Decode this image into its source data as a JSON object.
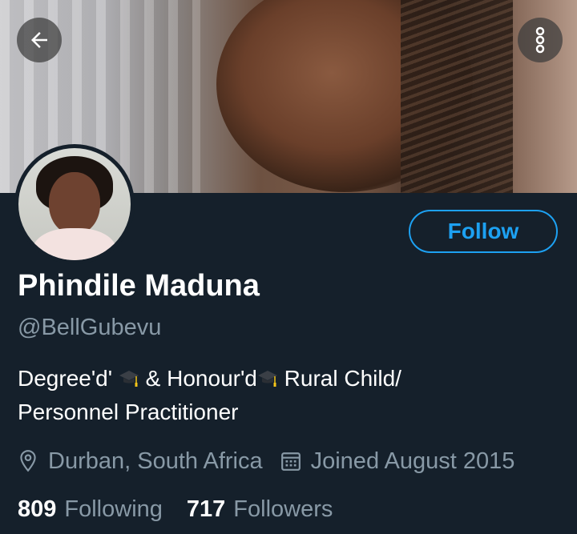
{
  "profile": {
    "name": "Phindile Maduna",
    "handle": "@BellGubevu",
    "bio": {
      "part1": "Degree'd'",
      "part2": "&  Honour'd",
      "part3": "Rural Child/",
      "line2": "Personnel Practitioner"
    },
    "location": "Durban, South Africa",
    "joined": "Joined August 2015",
    "following_count": "809",
    "following_label": "Following",
    "followers_count": "717",
    "followers_label": "Followers"
  },
  "actions": {
    "follow_label": "Follow"
  },
  "icons": {
    "back": "arrow-left-icon",
    "more": "more-vertical-icon",
    "location": "location-pin-icon",
    "calendar": "calendar-icon",
    "graduation": "graduation-cap-icon"
  },
  "colors": {
    "background": "#15202b",
    "accent": "#1da1f2",
    "secondary_text": "#8899a6"
  }
}
